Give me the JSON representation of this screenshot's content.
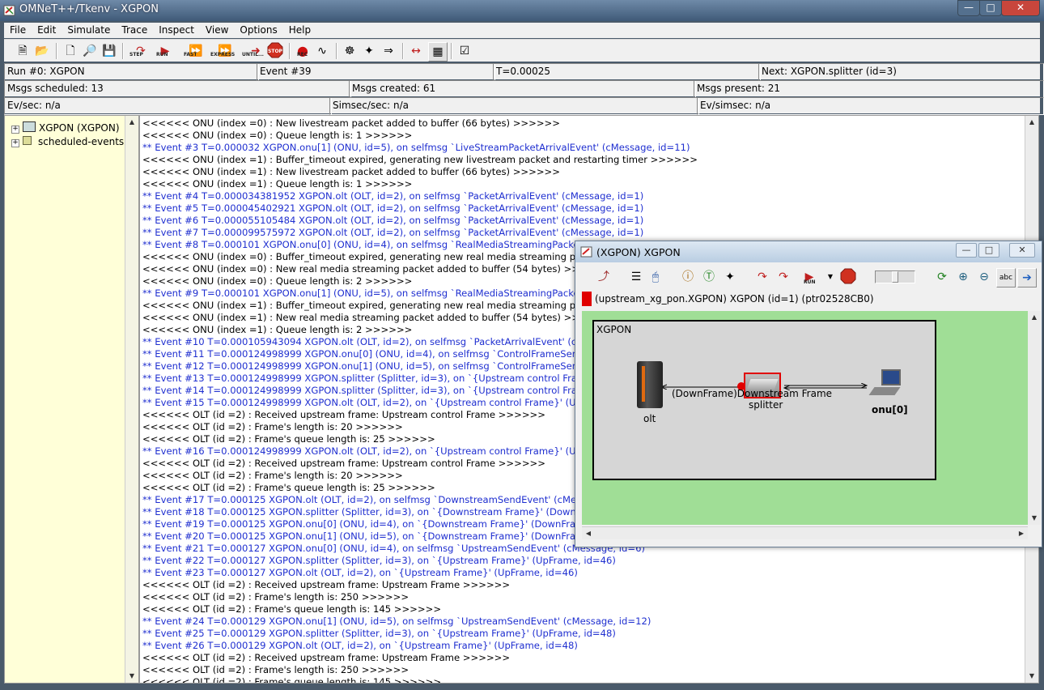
{
  "window": {
    "title": "OMNeT++/Tkenv - XGPON"
  },
  "menu": [
    "File",
    "Edit",
    "Simulate",
    "Trace",
    "Inspect",
    "View",
    "Options",
    "Help"
  ],
  "toolbar": {
    "step": "STEP",
    "run": "RUN",
    "fast": "FAST",
    "express": "EXPRESS",
    "until": "UNTIL...",
    "stop": "STOP",
    "rec": "REC"
  },
  "status": {
    "run": "Run #0: XGPON",
    "event": "Event #39",
    "time": "T=0.00025",
    "next": "Next: XGPON.splitter (id=3)",
    "msgs_scheduled": "Msgs scheduled: 13",
    "msgs_created": "Msgs created: 61",
    "msgs_present": "Msgs present: 21",
    "ev_sec": "Ev/sec: n/a",
    "simsec_sec": "Simsec/sec: n/a",
    "ev_simsec": "Ev/simsec: n/a"
  },
  "tree": {
    "root": "XGPON (XGPON)",
    "events": "scheduled-events"
  },
  "log": [
    {
      "t": "<<<<<< ONU (index =0) : New livestream packet added to buffer (66 bytes) >>>>>>",
      "e": false
    },
    {
      "t": "<<<<<< ONU (index =0) : Queue length is: 1 >>>>>>",
      "e": false
    },
    {
      "t": "** Event #3  T=0.000032  XGPON.onu[1] (ONU, id=5), on selfmsg `LiveStreamPacketArrivalEvent' (cMessage, id=11)",
      "e": true
    },
    {
      "t": "<<<<<< ONU (index =1) : Buffer_timeout expired, generating new livestream packet and restarting timer >>>>>>",
      "e": false
    },
    {
      "t": "<<<<<< ONU (index =1) : New livestream packet added to buffer (66 bytes) >>>>>>",
      "e": false
    },
    {
      "t": "<<<<<< ONU (index =1) : Queue length is: 1 >>>>>>",
      "e": false
    },
    {
      "t": "** Event #4  T=0.000034381952  XGPON.olt (OLT, id=2), on selfmsg `PacketArrivalEvent' (cMessage, id=1)",
      "e": true
    },
    {
      "t": "** Event #5  T=0.000045402921  XGPON.olt (OLT, id=2), on selfmsg `PacketArrivalEvent' (cMessage, id=1)",
      "e": true
    },
    {
      "t": "** Event #6  T=0.000055105484  XGPON.olt (OLT, id=2), on selfmsg `PacketArrivalEvent' (cMessage, id=1)",
      "e": true
    },
    {
      "t": "** Event #7  T=0.000099575972  XGPON.olt (OLT, id=2), on selfmsg `PacketArrivalEvent' (cMessage, id=1)",
      "e": true
    },
    {
      "t": "** Event #8  T=0.000101  XGPON.onu[0] (ONU, id=4), on selfmsg `RealMediaStreamingPacketArrivalEvent'",
      "e": true
    },
    {
      "t": "<<<<<< ONU (index =0) : Buffer_timeout expired, generating new real media streaming packet and re",
      "e": false
    },
    {
      "t": "<<<<<< ONU (index =0) : New real media streaming packet added to buffer (54 bytes) >>>>>>",
      "e": false
    },
    {
      "t": "<<<<<< ONU (index =0) : Queue length is: 2 >>>>>>",
      "e": false
    },
    {
      "t": "** Event #9  T=0.000101  XGPON.onu[1] (ONU, id=5), on selfmsg `RealMediaStreamingPacketArrivalEvent'",
      "e": true
    },
    {
      "t": "<<<<<< ONU (index =1) : Buffer_timeout expired, generating new real media streaming packet and re",
      "e": false
    },
    {
      "t": "<<<<<< ONU (index =1) : New real media streaming packet added to buffer (54 bytes) >>>>>>",
      "e": false
    },
    {
      "t": "<<<<<< ONU (index =1) : Queue length is: 2 >>>>>>",
      "e": false
    },
    {
      "t": "** Event #10  T=0.000105943094  XGPON.olt (OLT, id=2), on selfmsg `PacketArrivalEvent' (cMessage, id=1)",
      "e": true
    },
    {
      "t": "** Event #11  T=0.000124998999  XGPON.onu[0] (ONU, id=4), on selfmsg `ControlFrameSendEvent' (cM",
      "e": true
    },
    {
      "t": "** Event #12  T=0.000124998999  XGPON.onu[1] (ONU, id=5), on selfmsg `ControlFrameSendEvent' (cM",
      "e": true
    },
    {
      "t": "** Event #13  T=0.000124998999  XGPON.splitter (Splitter, id=3), on `{Upstream control Frame}' (UpFra",
      "e": true
    },
    {
      "t": "** Event #14  T=0.000124998999  XGPON.splitter (Splitter, id=3), on `{Upstream control Frame}' (UpFra",
      "e": true
    },
    {
      "t": "** Event #15  T=0.000124998999  XGPON.olt (OLT, id=2), on `{Upstream control Frame}' (UpFrame, id=",
      "e": true
    },
    {
      "t": "<<<<<< OLT (id =2) : Received upstream frame: Upstream control Frame >>>>>>",
      "e": false
    },
    {
      "t": "<<<<<< OLT (id =2) : Frame's length is: 20 >>>>>>",
      "e": false
    },
    {
      "t": "<<<<<< OLT (id =2) : Frame's queue length is: 25 >>>>>>",
      "e": false
    },
    {
      "t": "** Event #16  T=0.000124998999  XGPON.olt (OLT, id=2), on `{Upstream control Frame}' (UpFrame, id=",
      "e": true
    },
    {
      "t": "<<<<<< OLT (id =2) : Received upstream frame: Upstream control Frame >>>>>>",
      "e": false
    },
    {
      "t": "<<<<<< OLT (id =2) : Frame's length is: 20 >>>>>>",
      "e": false
    },
    {
      "t": "<<<<<< OLT (id =2) : Frame's queue length is: 25 >>>>>>",
      "e": false
    },
    {
      "t": "** Event #17  T=0.000125  XGPON.olt (OLT, id=2), on selfmsg `DownstreamSendEvent' (cMessage, id=",
      "e": true
    },
    {
      "t": "** Event #18  T=0.000125  XGPON.splitter (Splitter, id=3), on `{Downstream Frame}' (DownFrame, id=2",
      "e": true
    },
    {
      "t": "** Event #19  T=0.000125  XGPON.onu[0] (ONU, id=4), on `{Downstream Frame}' (DownFrame, id=30)",
      "e": true
    },
    {
      "t": "** Event #20  T=0.000125  XGPON.onu[1] (ONU, id=5), on `{Downstream Frame}' (DownFrame, id=38)",
      "e": true
    },
    {
      "t": "** Event #21  T=0.000127  XGPON.onu[0] (ONU, id=4), on selfmsg `UpstreamSendEvent' (cMessage, id=6)",
      "e": true
    },
    {
      "t": "** Event #22  T=0.000127  XGPON.splitter (Splitter, id=3), on `{Upstream Frame}' (UpFrame, id=46)",
      "e": true
    },
    {
      "t": "** Event #23  T=0.000127  XGPON.olt (OLT, id=2), on `{Upstream Frame}' (UpFrame, id=46)",
      "e": true
    },
    {
      "t": "<<<<<< OLT (id =2) : Received upstream frame: Upstream Frame >>>>>>",
      "e": false
    },
    {
      "t": "<<<<<< OLT (id =2) : Frame's length is: 250 >>>>>>",
      "e": false
    },
    {
      "t": "<<<<<< OLT (id =2) : Frame's queue length is: 145 >>>>>>",
      "e": false
    },
    {
      "t": "** Event #24  T=0.000129  XGPON.onu[1] (ONU, id=5), on selfmsg `UpstreamSendEvent' (cMessage, id=12)",
      "e": true
    },
    {
      "t": "** Event #25  T=0.000129  XGPON.splitter (Splitter, id=3), on `{Upstream Frame}' (UpFrame, id=48)",
      "e": true
    },
    {
      "t": "** Event #26  T=0.000129  XGPON.olt (OLT, id=2), on `{Upstream Frame}' (UpFrame, id=48)",
      "e": true
    },
    {
      "t": "<<<<<< OLT (id =2) : Received upstream frame: Upstream Frame >>>>>>",
      "e": false
    },
    {
      "t": "<<<<<< OLT (id =2) : Frame's length is: 250 >>>>>>",
      "e": false
    },
    {
      "t": "<<<<<< OLT (id =2) : Frame's queue length is: 145 >>>>>>",
      "e": false
    }
  ],
  "inspector": {
    "title": "(XGPON) XGPON",
    "path": "(upstream_xg_pon.XGPON) XGPON  (id=1)  (ptr02528CB0)",
    "module": "XGPON",
    "olt": "olt",
    "splitter": "splitter",
    "onu": "onu[0]",
    "message": "(DownFrame)Downstream Frame",
    "run": "RUN",
    "abc": "abc"
  },
  "colors": {
    "event_text": "#1f2fd0",
    "canvas_bg": "#a0de96",
    "tree_bg": "#ffffd8",
    "message_dot": "#e00000"
  }
}
